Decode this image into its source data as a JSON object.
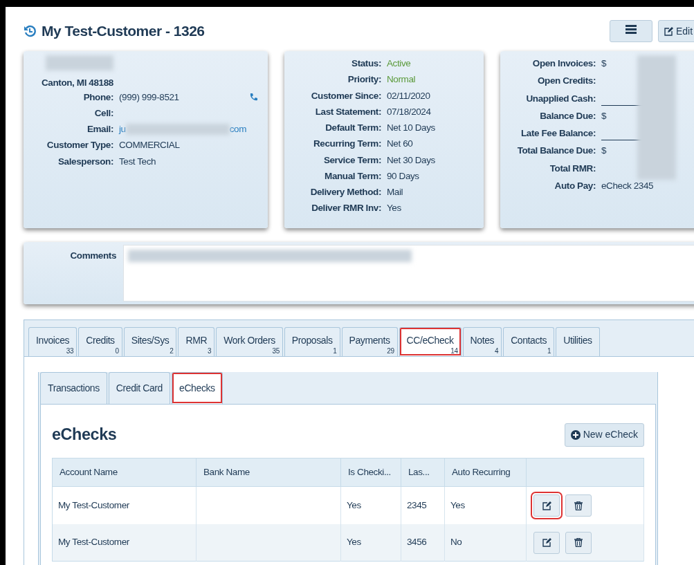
{
  "header": {
    "title": "My Test-Customer - 1326",
    "toolbar": [
      {
        "kind": "icon"
      },
      {
        "kind": "text",
        "label": "Edit"
      }
    ]
  },
  "contact": {
    "address": "Canton, MI 48188",
    "fields": [
      {
        "label": "Phone:",
        "value": "(999) 999-8521",
        "kind": "phone"
      },
      {
        "label": "Cell:",
        "kind": "plain"
      },
      {
        "label": "Email:",
        "value": "ju",
        "value_end": "com",
        "kind": "email"
      },
      {
        "label": "Customer Type:",
        "value": "COMMERCIAL",
        "kind": "plain"
      },
      {
        "label": "Salesperson:",
        "value": "Test Tech",
        "kind": "plain"
      }
    ]
  },
  "status": [
    {
      "label": "Status:",
      "value": "Active",
      "color": "#5b9a3b"
    },
    {
      "label": "Priority:",
      "value": "Normal",
      "color": "#5b9a3b"
    },
    {
      "label": "Customer Since:",
      "value": "02/11/2020",
      "color": "#1f3a55"
    },
    {
      "label": "Last Statement:",
      "value": "07/18/2024",
      "color": "#1f3a55"
    },
    {
      "label": "Default Term:",
      "value": "Net 10 Days",
      "color": "#1f3a55"
    },
    {
      "label": "Recurring Term:",
      "value": "Net 60",
      "color": "#1f3a55"
    },
    {
      "label": "Service Term:",
      "value": "Net 30 Days",
      "color": "#1f3a55"
    },
    {
      "label": "Manual Term:",
      "value": "90 Days",
      "color": "#1f3a55"
    },
    {
      "label": "Delivery Method:",
      "value": "Mail",
      "color": "#1f3a55"
    },
    {
      "label": "Deliver RMR Inv:",
      "value": "Yes",
      "color": "#1f3a55"
    }
  ],
  "balances": [
    {
      "label": "Open Invoices:",
      "value": "$",
      "underline": false
    },
    {
      "label": "Open Credits:",
      "underline": false
    },
    {
      "label": "Unapplied Cash:",
      "underline": true
    },
    {
      "label": "Balance Due:",
      "value": "$",
      "underline": false
    },
    {
      "label": "Late Fee Balance:",
      "underline": true
    },
    {
      "label": "Total Balance Due:",
      "value": "$",
      "underline": false
    },
    {
      "label": "Total RMR:",
      "underline": false
    },
    {
      "label": "Auto Pay:",
      "value": "eCheck 2345",
      "underline": false
    }
  ],
  "comments": {
    "label": "Comments"
  },
  "tabs": [
    {
      "label": "Invoices",
      "count": "33",
      "selected": false,
      "highlighted": false
    },
    {
      "label": "Credits",
      "count": "0",
      "selected": false,
      "highlighted": false
    },
    {
      "label": "Sites/Sys",
      "count": "2",
      "selected": false,
      "highlighted": false
    },
    {
      "label": "RMR",
      "count": "3",
      "selected": false,
      "highlighted": false
    },
    {
      "label": "Work Orders",
      "count": "35",
      "selected": false,
      "highlighted": false
    },
    {
      "label": "Proposals",
      "count": "1",
      "selected": false,
      "highlighted": false
    },
    {
      "label": "Payments",
      "count": "29",
      "selected": false,
      "highlighted": false
    },
    {
      "label": "CC/eCheck",
      "count": "14",
      "selected": true,
      "highlighted": true
    },
    {
      "label": "Notes",
      "count": "4",
      "selected": false,
      "highlighted": false
    },
    {
      "label": "Contacts",
      "count": "1",
      "selected": false,
      "highlighted": false
    },
    {
      "label": "Utilities",
      "selected": false,
      "highlighted": false
    }
  ],
  "subtabs": [
    {
      "label": "Transactions",
      "selected": false,
      "highlighted": false
    },
    {
      "label": "Credit Card",
      "selected": false,
      "highlighted": false
    },
    {
      "label": "eChecks",
      "selected": true,
      "highlighted": true
    }
  ],
  "section": {
    "title": "eChecks",
    "new_button": "New eCheck"
  },
  "table": {
    "columns": [
      "Account Name",
      "Bank Name",
      "Is Checki...",
      "Las...",
      "Auto Recurring"
    ],
    "rows": [
      {
        "cells": [
          "My Test-Customer",
          "",
          "Yes",
          "2345",
          "Yes"
        ],
        "edit_highlighted": true
      },
      {
        "cells": [
          "My Test-Customer",
          "",
          "Yes",
          "3456",
          "No"
        ],
        "edit_highlighted": false
      }
    ]
  }
}
